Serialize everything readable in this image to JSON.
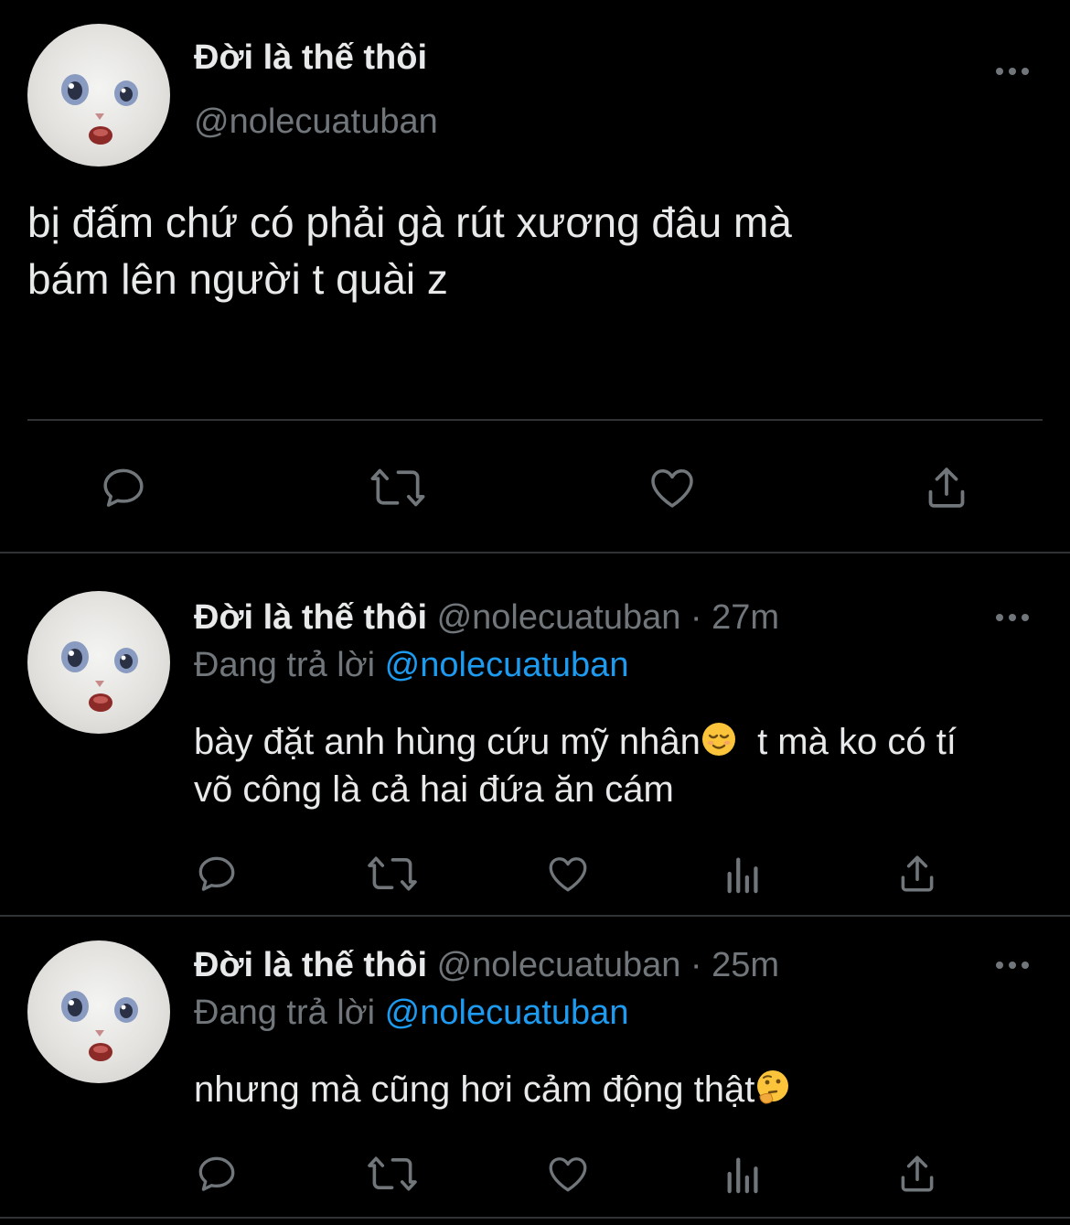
{
  "main_tweet": {
    "display_name": "Đời là thế thôi",
    "handle": "@nolecuatuban",
    "text_line1": "bị đấm chứ có phải gà rút xương đâu mà",
    "text_line2": "bám lên người t quài z",
    "icons": {
      "more": "more-icon",
      "reply": "reply-icon",
      "retweet": "retweet-icon",
      "like": "heart-icon",
      "share": "share-icon"
    }
  },
  "replies": [
    {
      "display_name": "Đời là thế thôi",
      "handle": "@nolecuatuban",
      "time": "· 27m",
      "replying_prefix": "Đang trả lời",
      "replying_to": "@nolecuatuban",
      "text_line1_a": "bày đặt anh hùng cứu mỹ nhân",
      "emoji1": "relieved-face-emoji",
      "text_line1_b": "t mà ko có tí",
      "text_line2": "võ công là cả hai đứa ăn cám"
    },
    {
      "display_name": "Đời là thế thôi",
      "handle": "@nolecuatuban",
      "time": "· 25m",
      "replying_prefix": "Đang trả lời",
      "replying_to": "@nolecuatuban",
      "text_line1": "nhưng mà cũng hơi cảm động thật",
      "emoji1": "thinking-face-emoji"
    }
  ],
  "colors": {
    "background": "#000000",
    "text": "#e7e9ea",
    "muted": "#71767b",
    "link": "#1d9bf0",
    "divider": "#2f3336"
  }
}
